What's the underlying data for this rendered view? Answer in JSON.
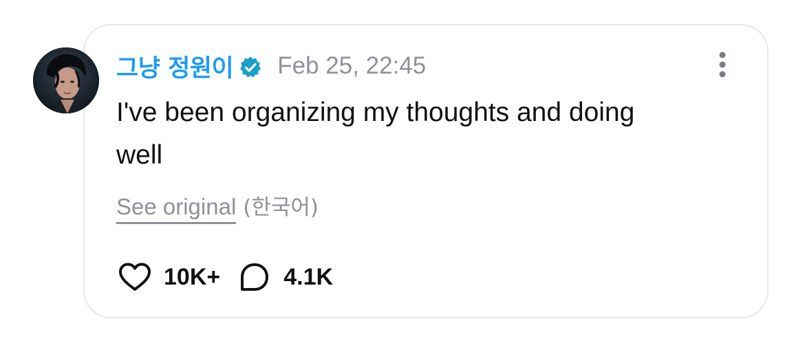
{
  "post": {
    "author": {
      "name": "그냥 정원이",
      "verified": true,
      "avatar": "avatar"
    },
    "timestamp": "Feb 25, 22:45",
    "text": "I've been organizing my thoughts and doing well",
    "translation": {
      "see_original_label": "See original",
      "language_label": "(한국어)"
    },
    "actions": {
      "likes": "10K+",
      "comments": "4.1K"
    },
    "icons": {
      "verified": "verified-badge-icon",
      "more": "more-vertical-icon",
      "like": "heart-icon",
      "comment": "comment-bubble-icon"
    },
    "colors": {
      "username": "#1d9bf0",
      "verified_badge": "#1aa0c8",
      "secondary_text": "#8e9196",
      "card_border": "#e6e7ea"
    }
  }
}
